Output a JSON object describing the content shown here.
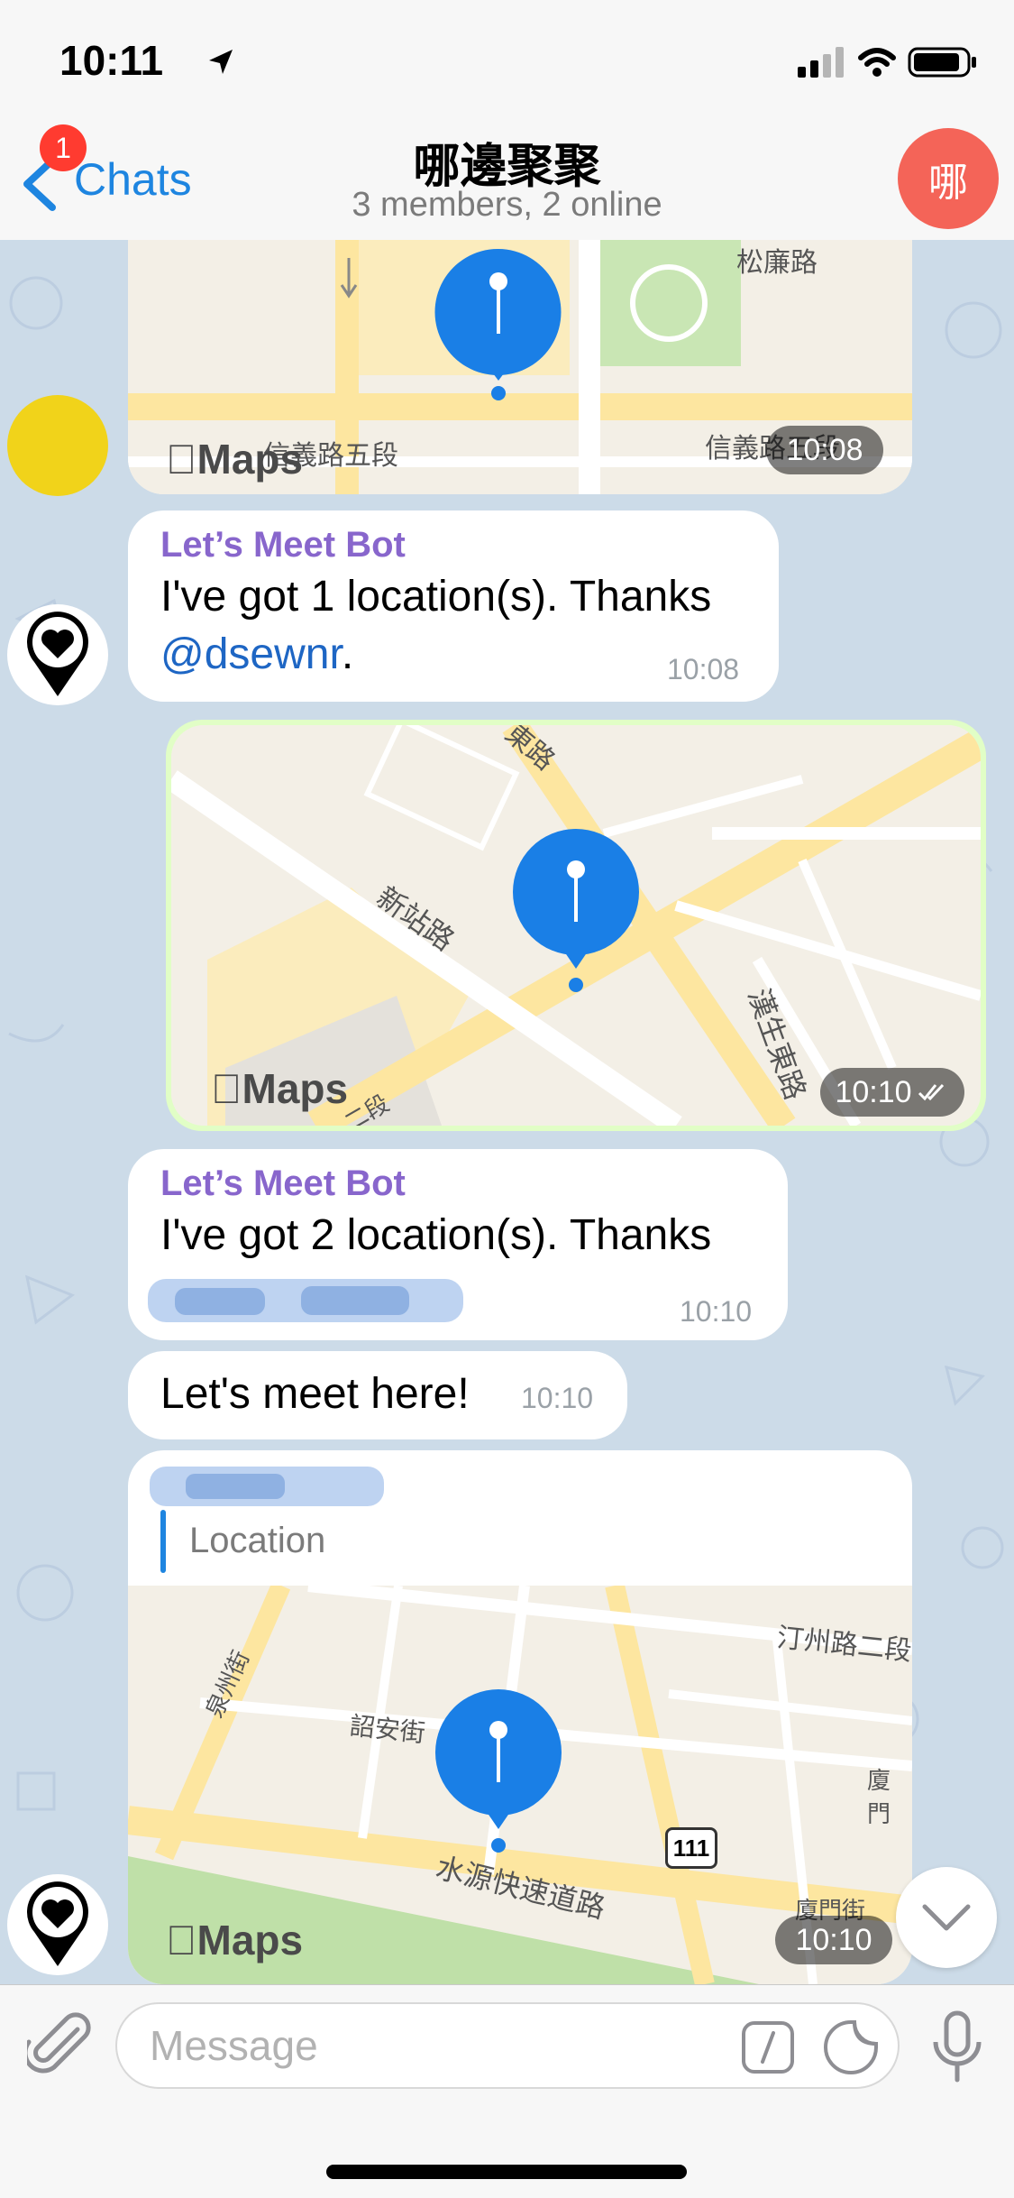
{
  "status": {
    "time": "10:11"
  },
  "nav": {
    "back_label": "Chats",
    "badge": "1",
    "title": "哪邊聚聚",
    "subtitle": "3 members, 2 online",
    "avatar_initial": "哪"
  },
  "messages": {
    "m1": {
      "type": "location",
      "time": "10:08",
      "street_labels": [
        "松廉路",
        "信義路五段",
        "信義路五段"
      ],
      "maps_label": "Maps"
    },
    "m2": {
      "sender": "Let’s Meet Bot",
      "text_before": "I've got 1 location(s). Thanks ",
      "mention": "@dsewnr",
      "text_after": ".",
      "time": "10:08"
    },
    "m3": {
      "type": "location",
      "time": "10:10",
      "street_labels": [
        "新站路",
        "漢生東路",
        "東路",
        "二段"
      ],
      "maps_label": "Maps"
    },
    "m4": {
      "sender": "Let’s Meet Bot",
      "text": "I've got 2 location(s). Thanks",
      "time": "10:10"
    },
    "m5": {
      "text": "Let's meet here!",
      "time": "10:10"
    },
    "m6": {
      "type": "venue",
      "reply_label": "Location",
      "time": "10:10",
      "street_labels": [
        "汀州路二段",
        "泉州街",
        "詔安街",
        "廈門",
        "水源快速道路",
        "廈門街"
      ],
      "road_shield": "111",
      "maps_label": "Maps"
    }
  },
  "input": {
    "placeholder": "Message"
  },
  "colors": {
    "accent": "#1e85e0",
    "badge": "#ff3b30",
    "avatar": "#f46458",
    "sender": "#8866cc",
    "pin": "#1a7fe6",
    "background": "#ccdbe8"
  }
}
